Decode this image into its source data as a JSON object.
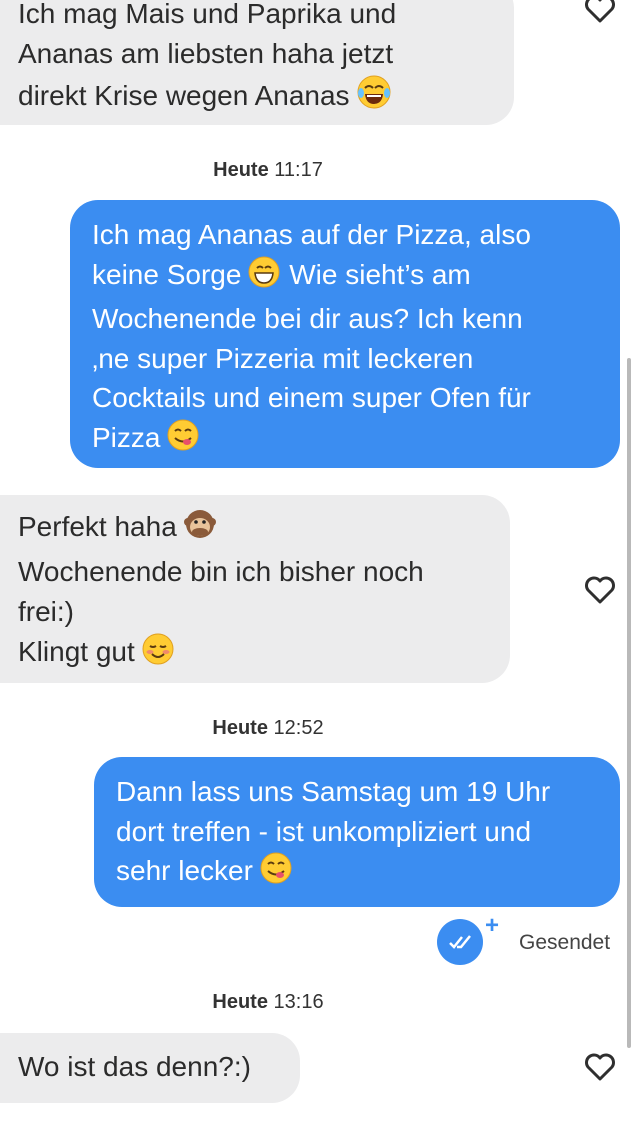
{
  "messages": [
    {
      "direction": "incoming",
      "lines": [
        "Ich mag Mais und Paprika und",
        "Ananas am liebsten haha jetzt",
        "direkt Krise wegen Ananas"
      ],
      "emoji": "face-with-tears-of-joy"
    },
    {
      "direction": "outgoing",
      "timestamp_day": "Heute",
      "timestamp_time": "11:17",
      "lines": [
        "Ich mag Ananas auf der Pizza, also",
        "keine Sorge",
        "Wie sieht’s am",
        "Wochenende bei dir aus? Ich kenn",
        "‚ne super Pizzeria mit leckeren",
        "Cocktails und einem super Ofen für",
        "Pizza"
      ],
      "emojis": [
        "grinning-face",
        "face-savoring-food"
      ]
    },
    {
      "direction": "incoming",
      "lines": [
        "Perfekt haha",
        "Wochenende bin ich bisher noch",
        "frei:)",
        "Klingt gut"
      ],
      "emojis": [
        "speak-no-evil-monkey",
        "smiling-face"
      ]
    },
    {
      "direction": "outgoing",
      "timestamp_day": "Heute",
      "timestamp_time": "12:52",
      "lines": [
        "Dann lass uns Samstag um 19 Uhr",
        "dort treffen - ist unkompliziert und",
        "sehr lecker"
      ],
      "emoji": "face-savoring-food"
    },
    {
      "direction": "incoming",
      "timestamp_day": "Heute",
      "timestamp_time": "13:16",
      "lines": [
        "Wo ist das denn?:)"
      ]
    }
  ],
  "status": {
    "label": "Gesendet",
    "plus": "+",
    "icon": "double-check-icon"
  },
  "icons": {
    "like": "heart-outline-icon"
  },
  "colors": {
    "outgoing": "#3b8df1",
    "incoming": "#ececed"
  }
}
